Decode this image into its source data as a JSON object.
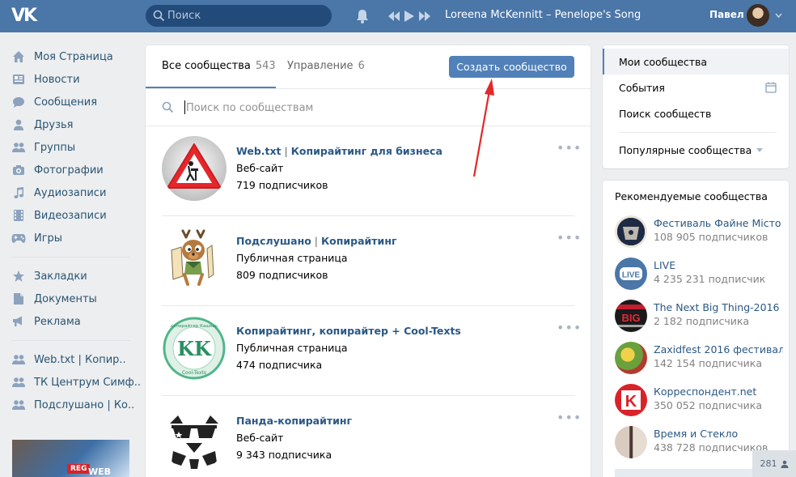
{
  "header": {
    "logo": "VK",
    "search_placeholder": "Поиск",
    "track": "Loreena McKennitt – Penelope's Song",
    "user_name": "Павел"
  },
  "left_nav": {
    "items": [
      {
        "label": "Моя Страница",
        "icon": "home-icon"
      },
      {
        "label": "Новости",
        "icon": "news-icon"
      },
      {
        "label": "Сообщения",
        "icon": "messages-icon"
      },
      {
        "label": "Друзья",
        "icon": "friend-icon"
      },
      {
        "label": "Группы",
        "icon": "groups-icon"
      },
      {
        "label": "Фотографии",
        "icon": "camera-icon"
      },
      {
        "label": "Аудиозаписи",
        "icon": "music-note-icon"
      },
      {
        "label": "Видеозаписи",
        "icon": "film-icon"
      },
      {
        "label": "Игры",
        "icon": "gamepad-icon"
      }
    ],
    "items2": [
      {
        "label": "Закладки",
        "icon": "star-icon"
      },
      {
        "label": "Документы",
        "icon": "document-icon"
      },
      {
        "label": "Реклама",
        "icon": "megaphone-icon"
      }
    ],
    "shortcuts": [
      {
        "label": "Web.txt | Копир..",
        "icon": "groups-icon"
      },
      {
        "label": "ТК Центрум Симф..",
        "icon": "groups-icon"
      },
      {
        "label": "Подслушано | Ко..",
        "icon": "groups-icon"
      }
    ],
    "ad": {
      "tag": "REG",
      "text": "WEB"
    }
  },
  "main": {
    "tabs": [
      {
        "label": "Все сообщества",
        "count": "543"
      },
      {
        "label": "Управление",
        "count": "6"
      }
    ],
    "create_button": "Создать сообщество",
    "search_placeholder": "Поиск по сообществам",
    "groups": [
      {
        "title": "Web.txt",
        "title_sep": " | ",
        "title_rest": "Копирайтинг для бизнеса",
        "kind": "Веб-сайт",
        "subs": "719 подписчиков"
      },
      {
        "title": "Подслушано",
        "title_sep": " | ",
        "title_rest": "Копирайтинг",
        "kind": "Публичная страница",
        "subs": "809 подписчиков"
      },
      {
        "title": "Копирайтинг, копирайтер + Cool-Texts",
        "title_sep": "",
        "title_rest": "",
        "kind": "Публичная страница",
        "subs": "474 подписчика"
      },
      {
        "title": "Панда-копирайтинг",
        "title_sep": "",
        "title_rest": "",
        "kind": "Веб-сайт",
        "subs": "9 343 подписчика"
      }
    ],
    "more_glyph": "•••",
    "group3_logo": "KK",
    "group3_ring_top": "Копирайтер Кашкин",
    "group3_ring_bottom": "Cool-Texts"
  },
  "right_nav": {
    "items": [
      "Мои сообщества",
      "События",
      "Поиск сообществ",
      "Популярные сообщества"
    ]
  },
  "recommended": {
    "title": "Рекомендуемые сообщества",
    "items": [
      {
        "name": "Фестиваль Файне Місто",
        "subs": "108 905 подписчиков"
      },
      {
        "name": "LIVE",
        "subs": "4 235 231 подписчик",
        "logo": "LIVE"
      },
      {
        "name": "The Next Big Thing-2016",
        "subs": "2 182 подписчика",
        "logo": "BIG"
      },
      {
        "name": "Zaxidfest 2016 фестиваль...",
        "subs": "142 154 подписчика"
      },
      {
        "name": "Корреспондент.net",
        "subs": "350 052 подписчика",
        "logo": "K"
      },
      {
        "name": "Время и Стекло",
        "subs": "438 728 подписчиков"
      }
    ]
  },
  "badge": {
    "count": "281"
  },
  "colors": {
    "header": "#4a76a8",
    "accent": "#5181b8",
    "link": "#2a5885",
    "arrow": "#e52727"
  }
}
